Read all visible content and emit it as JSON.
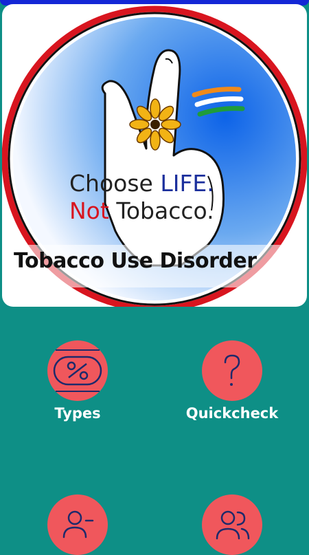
{
  "hero": {
    "logo_line1_a": "Choose ",
    "logo_line1_b": "LIFE.",
    "logo_line2_a": "Not ",
    "logo_line2_b": "Tobacco.",
    "title": "Tobacco Use Disorder"
  },
  "features": [
    {
      "label": "Types",
      "icon": "percent-icon"
    },
    {
      "label": "Quickcheck",
      "icon": "question-icon"
    },
    {
      "label": "",
      "icon": "person-icon"
    },
    {
      "label": "",
      "icon": "group-icon"
    }
  ],
  "colors": {
    "background": "#0e8f86",
    "accent": "#f0575c",
    "top_bar": "#1327d6"
  }
}
